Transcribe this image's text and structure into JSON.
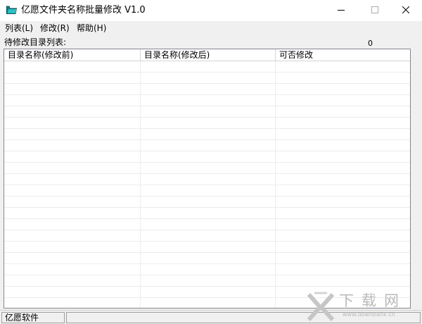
{
  "window": {
    "title": "亿愿文件夹名称批量修改 V1.0"
  },
  "menu": {
    "items": [
      {
        "label": "列表(L)"
      },
      {
        "label": "修改(R)"
      },
      {
        "label": "帮助(H)"
      }
    ]
  },
  "list": {
    "label": "待修改目录列表:",
    "count": "0",
    "columns": [
      {
        "label": "目录名称(修改前)"
      },
      {
        "label": "目录名称(修改后)"
      },
      {
        "label": "可否修改"
      }
    ],
    "rows": []
  },
  "statusbar": {
    "text": "亿愿软件"
  },
  "watermark": {
    "text": "下载网",
    "url": "www.downbank.cn"
  },
  "colors": {
    "window_bg": "#f0f0f0",
    "list_bg": "#ffffff",
    "icon_teal": "#1a9ba0",
    "watermark": "#b9b9b9"
  },
  "icons": {
    "app": "folder-icon",
    "minimize": "minimize-icon",
    "maximize": "maximize-icon",
    "close": "close-icon"
  }
}
